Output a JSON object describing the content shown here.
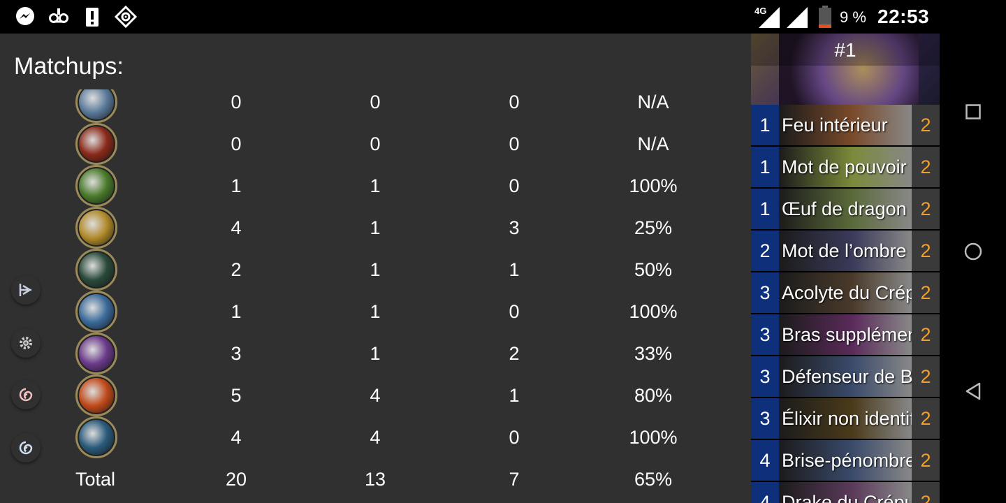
{
  "statusbar": {
    "network": "4G",
    "battery_percent": "9 %",
    "time": "22:53",
    "left_icons": [
      "messenger-icon",
      "voicemail-icon",
      "alert-icon",
      "location-icon"
    ]
  },
  "matchups": {
    "title": "Matchups:",
    "rows": [
      {
        "icon": "warrior-class-icon",
        "color": "#5a7a9a",
        "games": "0",
        "wins": "0",
        "losses": "0",
        "winrate": "N/A"
      },
      {
        "icon": "warlock-class-icon",
        "color": "#8a2a1a",
        "games": "0",
        "wins": "0",
        "losses": "0",
        "winrate": "N/A"
      },
      {
        "icon": "hunter-class-icon",
        "color": "#4a7a2a",
        "games": "1",
        "wins": "1",
        "losses": "0",
        "winrate": "100%"
      },
      {
        "icon": "paladin-class-icon",
        "color": "#b08a2a",
        "games": "4",
        "wins": "1",
        "losses": "3",
        "winrate": "25%"
      },
      {
        "icon": "rogue-class-icon",
        "color": "#2a4a3a",
        "games": "2",
        "wins": "1",
        "losses": "1",
        "winrate": "50%"
      },
      {
        "icon": "shaman-class-icon",
        "color": "#3a6a9a",
        "games": "1",
        "wins": "1",
        "losses": "0",
        "winrate": "100%"
      },
      {
        "icon": "priest-class-icon",
        "color": "#6a3a8a",
        "games": "3",
        "wins": "1",
        "losses": "2",
        "winrate": "33%"
      },
      {
        "icon": "mage-class-icon",
        "color": "#c04a1a",
        "games": "5",
        "wins": "4",
        "losses": "1",
        "winrate": "80%"
      },
      {
        "icon": "druid-class-icon",
        "color": "#2a5a7a",
        "games": "4",
        "wins": "4",
        "losses": "0",
        "winrate": "100%"
      }
    ],
    "total": {
      "label": "Total",
      "games": "20",
      "wins": "13",
      "losses": "7",
      "winrate": "65%"
    }
  },
  "fabs": [
    {
      "icon": "hsreplay-icon",
      "color": "#2e4466"
    },
    {
      "icon": "settings-icon",
      "color": "#6a6a6a"
    },
    {
      "icon": "hearthstone-opponent-icon",
      "color": "#b05050"
    },
    {
      "icon": "hearthstone-player-icon",
      "color": "#4a7aaa"
    }
  ],
  "deck": {
    "title": "#1",
    "cards": [
      {
        "cost": "1",
        "name": "Feu intérieur",
        "count": "2",
        "art": "#7a4a2a"
      },
      {
        "cost": "1",
        "name": "Mot de pouvoir",
        "count": "2",
        "art": "#7a8a3a"
      },
      {
        "cost": "1",
        "name": "Œuf de dragon",
        "count": "2",
        "art": "#5a6a3a"
      },
      {
        "cost": "2",
        "name": "Mot de l’ombre",
        "count": "2",
        "art": "#3a3a5a"
      },
      {
        "cost": "3",
        "name": "Acolyte du Crépuscule",
        "count": "2",
        "art": "#4a3a2a"
      },
      {
        "cost": "3",
        "name": "Bras supplémentaires",
        "count": "2",
        "art": "#5a2a5a"
      },
      {
        "cost": "3",
        "name": "Défenseur de Bronze",
        "count": "2",
        "art": "#3a4a6a"
      },
      {
        "cost": "3",
        "name": "Élixir non identifié",
        "count": "2",
        "art": "#4a3a1a"
      },
      {
        "cost": "4",
        "name": "Brise-pénombre",
        "count": "2",
        "art": "#3a4a6a"
      },
      {
        "cost": "4",
        "name": "Drake du Crépuscule",
        "count": "2",
        "art": "#5a3a5a"
      }
    ]
  },
  "navbar": [
    "recents-button",
    "home-button",
    "back-button"
  ]
}
